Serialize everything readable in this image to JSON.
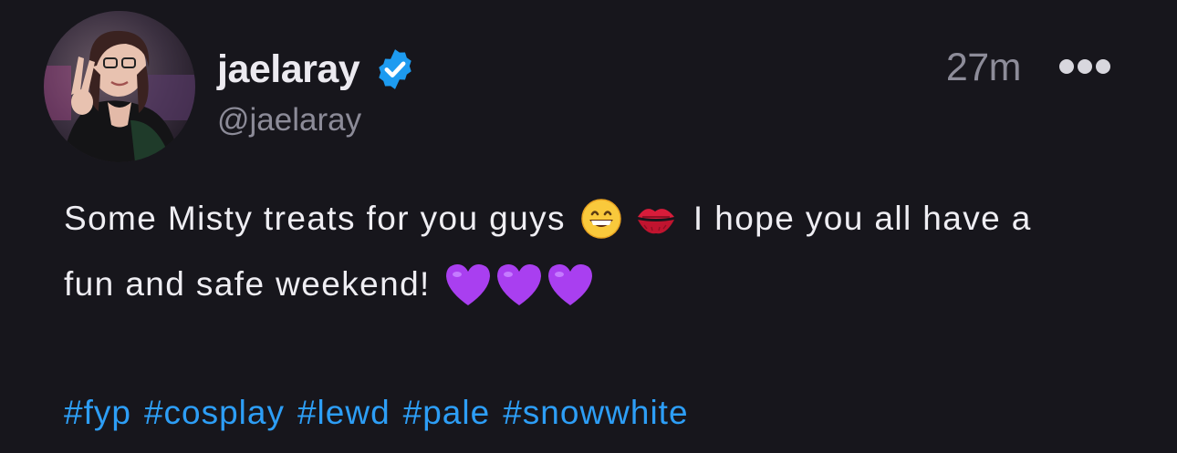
{
  "user": {
    "display_name": "jaelaray",
    "handle": "@jaelaray",
    "verified": true,
    "avatar": "profile-photo"
  },
  "post": {
    "timestamp": "27m",
    "line1_part1": "Some Misty treats for you guys",
    "line1_part2": "I hope you all have a",
    "line2": "fun and safe weekend!",
    "emojis": [
      "grinning-face-icon",
      "kiss-mark-icon",
      "purple-heart-icon",
      "purple-heart-icon",
      "purple-heart-icon"
    ],
    "hashtags": [
      "#fyp",
      "#cosplay",
      "#lewd",
      "#pale",
      "#snowwhite"
    ]
  },
  "colors": {
    "background": "#17161c",
    "hashtag": "#2d9ef6",
    "verified_badge": "#1d9bf0",
    "secondary_text": "#8c8b98"
  }
}
